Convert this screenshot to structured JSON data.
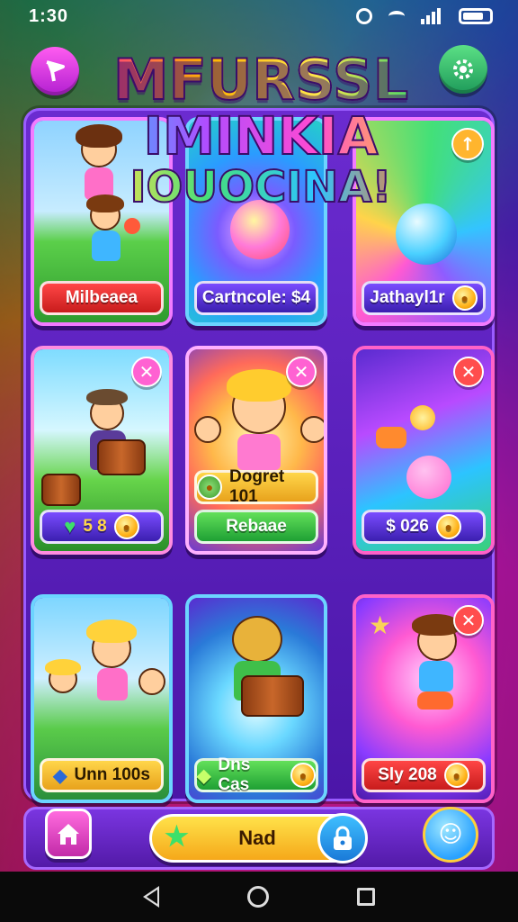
{
  "status_bar": {
    "time": "1:30"
  },
  "header": {
    "title_line1": "MFURSSL",
    "title_line2": "IMINKIA",
    "title_line3": "IOUOCINA!",
    "menu_icon": "flag-icon",
    "settings_icon": "gear-icon"
  },
  "cards": [
    {
      "label": "Milbeaea",
      "label_style": "red",
      "icon": "none",
      "badge": "none"
    },
    {
      "label": "Cartncole: $4",
      "label_style": "blue",
      "icon": "none",
      "badge": "none"
    },
    {
      "label": "Jathayl1r",
      "label_style": "blue",
      "icon": "coin-icon",
      "badge": "up-arrow-icon"
    },
    {
      "label": "5 8",
      "label_style": "blue",
      "icon": "heart-icon",
      "badge": "close-icon"
    },
    {
      "label": "Dogret 101",
      "label_style": "gold",
      "icon": "coin-icon",
      "badge": "close-icon"
    },
    {
      "label": "$ 026",
      "label_style": "blue",
      "icon": "coin-icon",
      "badge": "close-icon"
    },
    {
      "label": "Unn 100s",
      "label_style": "gold",
      "icon": "gem-icon",
      "badge": "none"
    },
    {
      "label": "Dns Cas",
      "label_style": "green",
      "icon": "coin-icon",
      "badge": "none"
    },
    {
      "label": "Sly 208",
      "label_style": "red",
      "icon": "coin-icon",
      "badge": "close-icon"
    }
  ],
  "extra_button": {
    "label": "Rebaae"
  },
  "bottom_bar": {
    "play_label": "Nad",
    "home_icon": "home-icon",
    "star_icon": "star-icon",
    "lock_icon": "lock-icon",
    "mascot_icon": "mascot-icon"
  },
  "nav": {
    "back_icon": "back-icon",
    "home_icon": "home-circle-icon",
    "recent_icon": "recent-apps-icon"
  },
  "colors": {
    "panel": "#6b2bd0",
    "accent_pink": "#f37bff",
    "gold": "#ffd64a",
    "green": "#3de06a"
  }
}
